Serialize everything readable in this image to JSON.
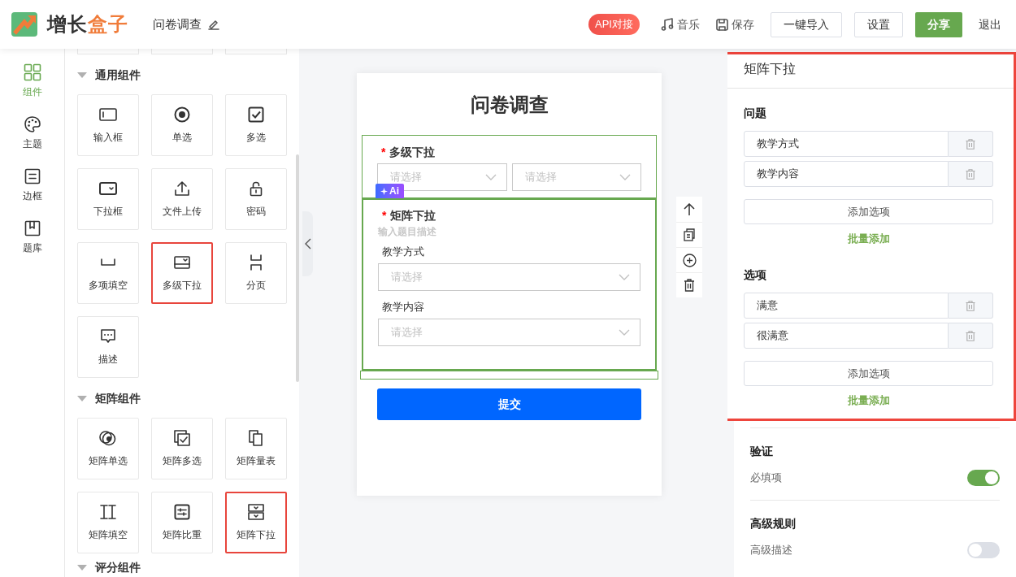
{
  "header": {
    "logo": {
      "text": "增长",
      "accent": "盒子"
    },
    "title": "问卷调查",
    "actions": [
      {
        "kind": "badge",
        "label": "API对接"
      },
      {
        "kind": "music-link",
        "label": "音乐"
      },
      {
        "kind": "save-link",
        "label": "保存"
      },
      {
        "kind": "outline-button",
        "label": "一键导入"
      },
      {
        "kind": "outline-button",
        "label": "设置"
      },
      {
        "kind": "primary-button",
        "label": "分享"
      },
      {
        "kind": "text-link",
        "label": "退出"
      }
    ]
  },
  "rail": [
    {
      "label": "组件",
      "selected": true
    },
    {
      "label": "主题",
      "selected": false
    },
    {
      "label": "边框",
      "selected": false
    },
    {
      "label": "题库",
      "selected": false
    }
  ],
  "components": {
    "sections": [
      {
        "title": "通用组件",
        "expanded": true,
        "items": [
          {
            "label": "输入框",
            "highlighted": false
          },
          {
            "label": "单选",
            "highlighted": false
          },
          {
            "label": "多选",
            "highlighted": false
          },
          {
            "label": "下拉框",
            "highlighted": false
          },
          {
            "label": "文件上传",
            "highlighted": false
          },
          {
            "label": "密码",
            "highlighted": false
          },
          {
            "label": "多项填空",
            "highlighted": false
          },
          {
            "label": "多级下拉",
            "highlighted": true
          },
          {
            "label": "分页",
            "highlighted": false
          },
          {
            "label": "描述",
            "highlighted": false
          }
        ]
      },
      {
        "title": "矩阵组件",
        "expanded": true,
        "items": [
          {
            "label": "矩阵单选",
            "highlighted": false
          },
          {
            "label": "矩阵多选",
            "highlighted": false
          },
          {
            "label": "矩阵量表",
            "highlighted": false
          },
          {
            "label": "矩阵填空",
            "highlighted": false
          },
          {
            "label": "矩阵比重",
            "highlighted": false
          },
          {
            "label": "矩阵下拉",
            "highlighted": true
          }
        ]
      },
      {
        "title": "评分组件",
        "expanded": true
      }
    ]
  },
  "form": {
    "title": "问卷调查",
    "ai_badge": "Ai",
    "questions": [
      {
        "kind": "cascade",
        "title": "多级下拉",
        "required_mark": "*",
        "selected": false,
        "selects": [
          "请选择",
          "请选择"
        ]
      },
      {
        "kind": "matrix",
        "title": "矩阵下拉",
        "required_mark": "*",
        "selected": true,
        "description_placeholder": "输入题目描述",
        "rows": [
          {
            "label": "教学方式",
            "placeholder": "请选择"
          },
          {
            "label": "教学内容",
            "placeholder": "请选择"
          }
        ]
      }
    ],
    "submit": "提交"
  },
  "properties": {
    "title": "矩阵下拉",
    "highlighted": true,
    "groups": [
      {
        "title": "问题",
        "options": [
          "教学方式",
          "教学内容"
        ],
        "add_button": "添加选项",
        "bulk_link": "批量添加"
      },
      {
        "title": "选项",
        "options": [
          "满意",
          "很满意"
        ],
        "add_button": "添加选项",
        "bulk_link": "批量添加"
      }
    ],
    "sections": [
      {
        "title": "验证",
        "toggles": [
          {
            "label": "必填项",
            "on": true
          }
        ]
      },
      {
        "title": "高级规则",
        "toggles": [
          {
            "label": "高级描述",
            "on": false
          }
        ]
      }
    ]
  }
}
